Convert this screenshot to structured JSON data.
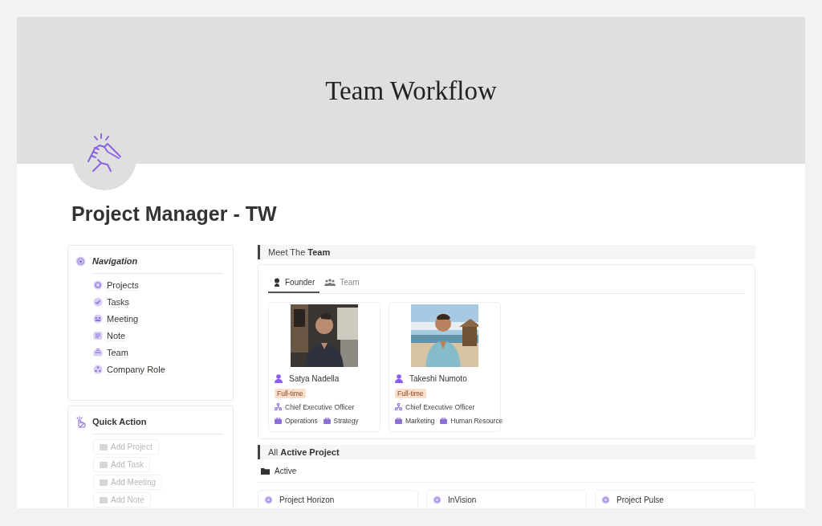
{
  "cover": {
    "title": "Team Workflow"
  },
  "page": {
    "title": "Project Manager - TW"
  },
  "navigation": {
    "title": "Navigation",
    "items": [
      {
        "label": "Projects"
      },
      {
        "label": "Tasks"
      },
      {
        "label": "Meeting"
      },
      {
        "label": "Note"
      },
      {
        "label": "Team"
      },
      {
        "label": "Company Role"
      }
    ]
  },
  "quick_action": {
    "title": "Quick Action",
    "buttons": [
      {
        "label": "Add Project",
        "disabled": true
      },
      {
        "label": "Add Task",
        "disabled": true
      },
      {
        "label": "Add Meeting",
        "disabled": true
      },
      {
        "label": "Add Note",
        "disabled": true
      }
    ]
  },
  "team_section": {
    "heading": "Meet The **Team**",
    "tabs": [
      {
        "label": "Founder",
        "selected": true
      },
      {
        "label": "Team",
        "selected": false
      }
    ],
    "members": [
      {
        "photo": {
          "kind": "picture"
        },
        "name": "Satya Nadella",
        "employment": "Full-time",
        "role": "Chief Executive Officer",
        "departments": [
          "Operations",
          "Strategy"
        ]
      },
      {
        "photo": {
          "kind": "picture"
        },
        "name": "Takeshi Numoto",
        "employment": "Full-time",
        "role": "Chief Executive Officer",
        "departments": [
          "Marketing",
          "Human Resource"
        ]
      }
    ]
  },
  "projects_section": {
    "heading": "All **Active Project**",
    "view": "Active",
    "projects": [
      {
        "name": "Project Horizon"
      },
      {
        "name": "InVision"
      },
      {
        "name": "Project Pulse"
      }
    ]
  }
}
